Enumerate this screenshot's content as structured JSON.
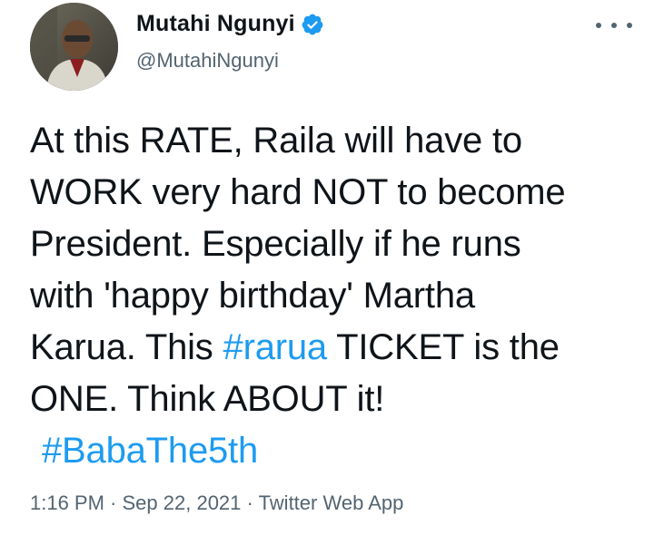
{
  "author": {
    "name": "Mutahi Ngunyi",
    "handle": "@MutahiNgunyi",
    "avatar_icon": "profile-photo"
  },
  "tweet": {
    "lines": [
      {
        "text": "At this RATE, Raila will have to"
      },
      {
        "text": "WORK very hard NOT to become"
      },
      {
        "text": "President. Especially if he runs"
      },
      {
        "text": "with 'happy birthday' Martha"
      },
      {
        "before": "Karua. This ",
        "hashtag": "#rarua",
        "after": " TICKET is the"
      },
      {
        "text": "ONE. Think ABOUT it!"
      }
    ],
    "closing_hashtag": "#BabaThe5th"
  },
  "meta": {
    "time": "1:16 PM",
    "separator": " · ",
    "date": "Sep 22, 2021",
    "source": "Twitter Web App"
  },
  "colors": {
    "link": "#1d9bf0",
    "secondary": "#536471",
    "text": "#0f1419"
  }
}
